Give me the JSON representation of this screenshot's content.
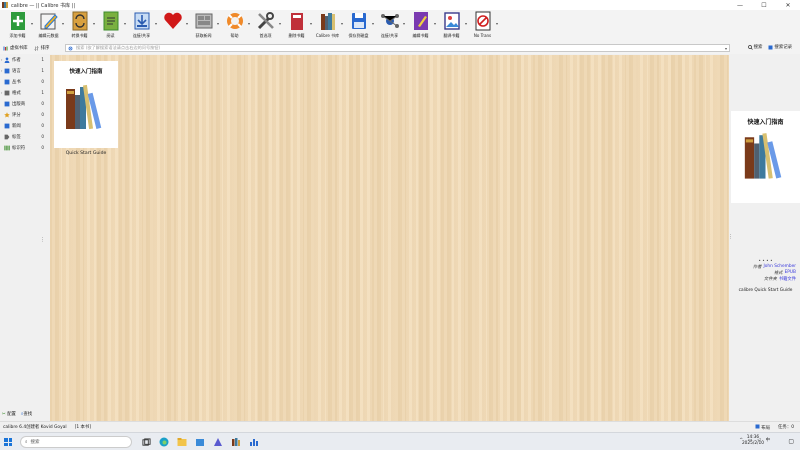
{
  "window": {
    "title": "calibre — || Calibre 书库 ||",
    "controls": [
      "—",
      "☐",
      "✕"
    ]
  },
  "toolbar": [
    {
      "name": "add-books-button",
      "label": "添加书籍",
      "icon": "plus-book-icon",
      "color": "#2e9b3c"
    },
    {
      "name": "edit-metadata-button",
      "label": "编辑元数据",
      "icon": "pencil-icon",
      "color": "#2a7bd6"
    },
    {
      "name": "convert-books-button",
      "label": "转换书籍",
      "icon": "convert-icon",
      "color": "#8a6a2a"
    },
    {
      "name": "view-button",
      "label": "阅读",
      "icon": "book-view-icon",
      "color": "#3c8c2c"
    },
    {
      "name": "send-to-device-button",
      "label": "连接/共享",
      "icon": "download-icon",
      "color": "#2a5bb0"
    },
    {
      "name": "donate-button",
      "label": "",
      "icon": "heart-icon",
      "color": "#d01818"
    },
    {
      "name": "fetch-news-button",
      "label": "获取新闻",
      "icon": "news-icon",
      "color": "#666666"
    },
    {
      "name": "help-button",
      "label": "帮助",
      "icon": "lifebuoy-icon",
      "color": "#f08a2a"
    },
    {
      "name": "preferences-button",
      "label": "首选项",
      "icon": "tools-icon",
      "color": "#444444"
    },
    {
      "name": "remove-books-button",
      "label": "删除书籍",
      "icon": "trash-icon",
      "color": "#c0303a"
    },
    {
      "name": "calibre-library-button",
      "label": "Calibre 书库",
      "icon": "library-icon",
      "color": "#6a4a2a"
    },
    {
      "name": "save-to-disk-button",
      "label": "保存到磁盘",
      "icon": "floppy-icon",
      "color": "#2a6ad0"
    },
    {
      "name": "connect-share-button",
      "label": "连接/共享",
      "icon": "share-network-icon",
      "color": "#2a5bb0"
    },
    {
      "name": "edit-book-button",
      "label": "编辑书籍",
      "icon": "edit-book-icon",
      "color": "#7a3ab0"
    },
    {
      "name": "virtual-library-button",
      "label": "翻译书籍",
      "icon": "picture-icon",
      "color": "#3a3a8a"
    },
    {
      "name": "no-trans-button",
      "label": "No Trans",
      "icon": "no-trans-icon",
      "color": "#333333"
    }
  ],
  "searchbar": {
    "virtual_library": "虚拟书库",
    "sort": "排序",
    "placeholder": "搜索 (欲了解搜索语法请点击右边的问号按钮)",
    "search_label": "搜索",
    "saved_search_label": "搜索记录"
  },
  "tag_browser": {
    "items": [
      {
        "name": "tag-authors",
        "label": "作者",
        "count": "1",
        "icon": "person-icon",
        "color": "#2a6ad0",
        "arrow": "›"
      },
      {
        "name": "tag-languages",
        "label": "语言",
        "count": "1",
        "icon": "language-icon",
        "color": "#2a6ad0",
        "arrow": "›"
      },
      {
        "name": "tag-series",
        "label": "丛书",
        "count": "0",
        "icon": "series-icon",
        "color": "#2a6ad0",
        "arrow": ""
      },
      {
        "name": "tag-formats",
        "label": "格式",
        "count": "1",
        "icon": "format-icon",
        "color": "#666666",
        "arrow": "›"
      },
      {
        "name": "tag-publisher",
        "label": "出版商",
        "count": "0",
        "icon": "publisher-icon",
        "color": "#2a6ad0",
        "arrow": ""
      },
      {
        "name": "tag-rating",
        "label": "评分",
        "count": "0",
        "icon": "star-icon",
        "color": "#e0a020",
        "arrow": ""
      },
      {
        "name": "tag-news",
        "label": "新闻",
        "count": "0",
        "icon": "news-icon",
        "color": "#2a6ad0",
        "arrow": ""
      },
      {
        "name": "tag-tags",
        "label": "标签",
        "count": "0",
        "icon": "tag-icon",
        "color": "#666666",
        "arrow": ""
      },
      {
        "name": "tag-identifiers",
        "label": "标识符",
        "count": "0",
        "icon": "barcode-icon",
        "color": "#3c8c2c",
        "arrow": ""
      }
    ],
    "footer_configure": "配置",
    "footer_find": "查找"
  },
  "grid": {
    "books": [
      {
        "cover_title": "快速入门指南",
        "caption": "Quick Start Guide"
      }
    ]
  },
  "details": {
    "cover_title": "快速入门指南",
    "dots": "• • • •",
    "author_label": "作者",
    "author_value": "John Schember",
    "format_label": "格式",
    "format_value": "EPUB",
    "folder_label": "文件夹",
    "folder_value": "书籍文件",
    "book_title": "calibre Quick Start Guide"
  },
  "statusbar": {
    "left": "calibre 6.4创建者 Kovid Goyal",
    "count": "[1 本书]",
    "layout": "布局",
    "jobs": "任务：0"
  },
  "taskbar": {
    "search_placeholder": "搜索",
    "time": "14:36",
    "date": "2025/2/10",
    "lang": "中",
    "tray_up": "^"
  }
}
